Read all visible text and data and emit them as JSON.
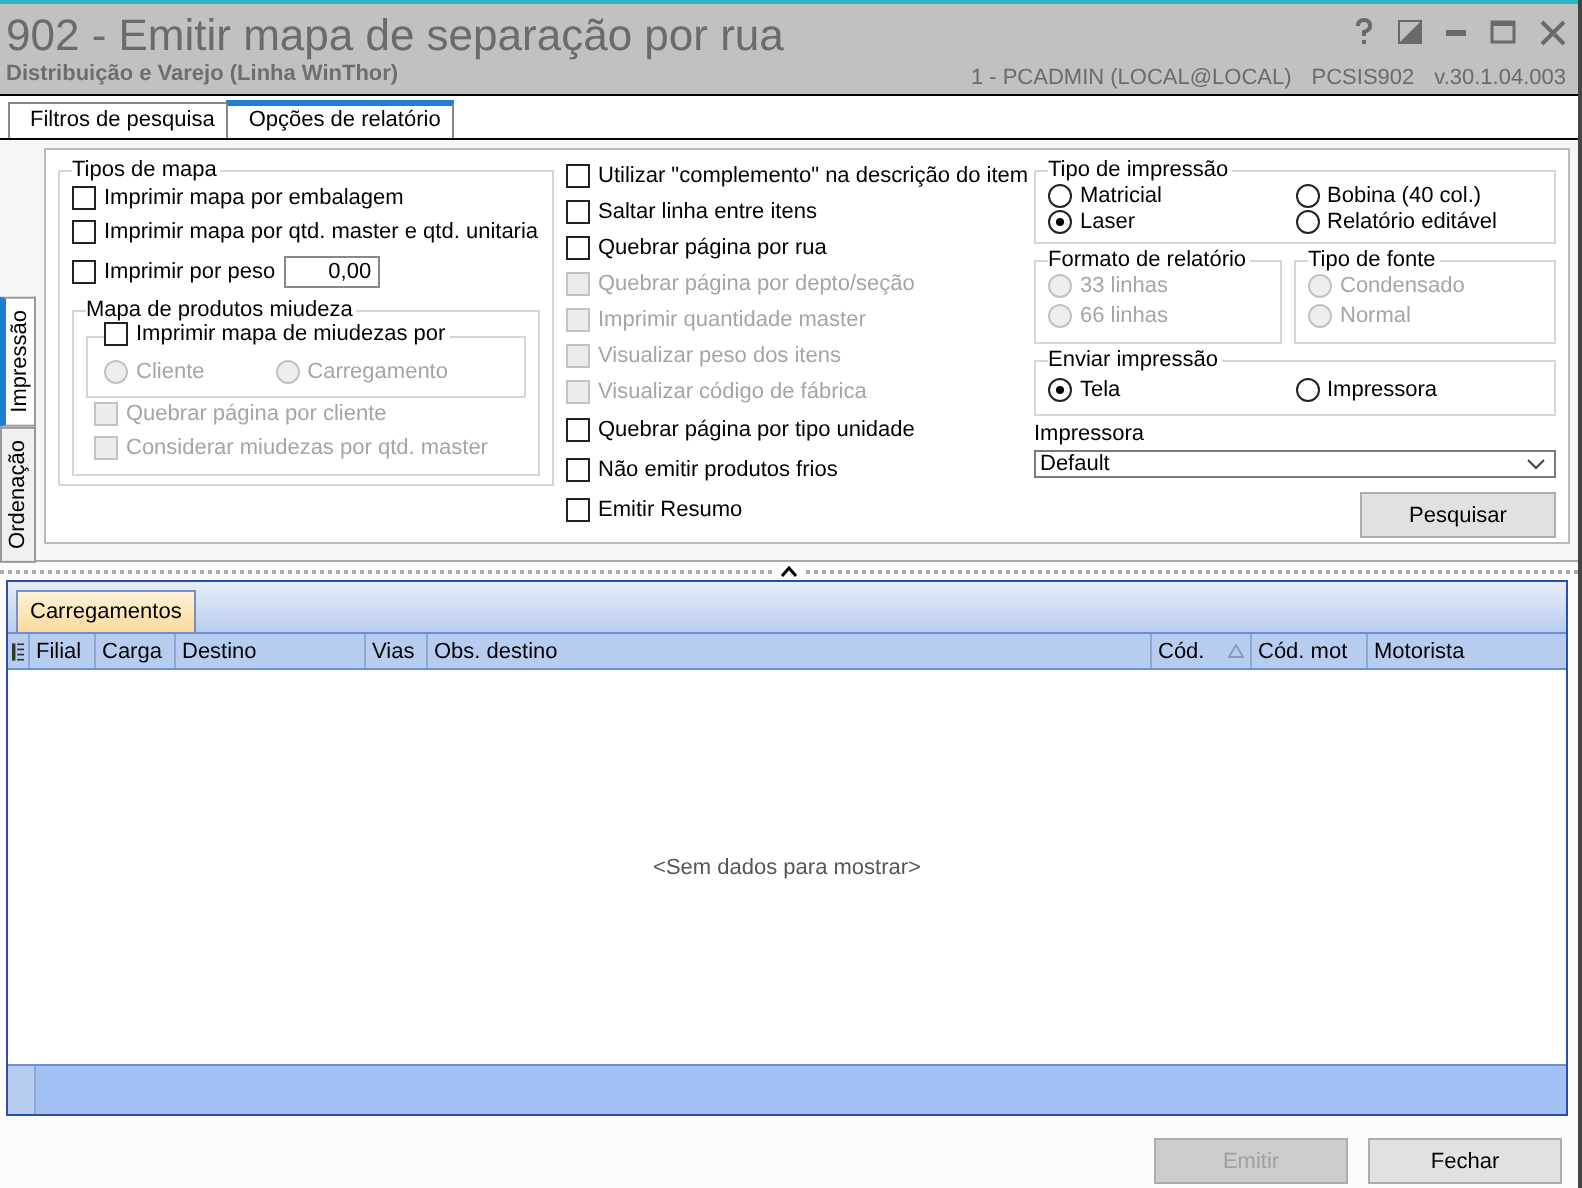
{
  "window": {
    "title": "902 - Emitir mapa de separação por rua",
    "subtitle": "Distribuição e Varejo (Linha WinThor)",
    "user": "1 - PCADMIN (LOCAL@LOCAL)",
    "program": "PCSIS902",
    "version": "v.30.1.04.003"
  },
  "tabs": [
    {
      "label": "Filtros de pesquisa",
      "selected": false
    },
    {
      "label": "Opções de relatório",
      "selected": true
    }
  ],
  "side_tabs": [
    {
      "label": "Impressão",
      "selected": true
    },
    {
      "label": "Ordenação",
      "selected": false
    }
  ],
  "tipos_de_mapa": {
    "legend": "Tipos de mapa",
    "options": [
      {
        "label": "Imprimir mapa por embalagem",
        "checked": false,
        "disabled": false
      },
      {
        "label": "Imprimir mapa por qtd. master e qtd. unitaria",
        "checked": false,
        "disabled": false
      },
      {
        "label": "Imprimir por peso",
        "checked": false,
        "disabled": false,
        "field_value": "0,00"
      }
    ],
    "miudeza": {
      "legend": "Mapa de produtos miudeza",
      "toggle": {
        "label": "Imprimir mapa de miudezas por",
        "checked": false,
        "disabled": false
      },
      "radios": [
        {
          "label": "Cliente",
          "selected": false,
          "disabled": true
        },
        {
          "label": "Carregamento",
          "selected": false,
          "disabled": true
        }
      ],
      "options": [
        {
          "label": "Quebrar página por cliente",
          "checked": false,
          "disabled": true
        },
        {
          "label": "Considerar miudezas por qtd. master",
          "checked": false,
          "disabled": true
        }
      ]
    }
  },
  "options": [
    {
      "label": "Utilizar \"complemento\" na descrição do item",
      "checked": false,
      "disabled": false
    },
    {
      "label": "Saltar linha entre itens",
      "checked": false,
      "disabled": false
    },
    {
      "label": "Quebrar página por rua",
      "checked": false,
      "disabled": false
    },
    {
      "label": "Quebrar página por depto/seção",
      "checked": false,
      "disabled": true
    },
    {
      "label": "Imprimir quantidade master",
      "checked": false,
      "disabled": true
    },
    {
      "label": "Visualizar peso dos itens",
      "checked": false,
      "disabled": true
    },
    {
      "label": "Visualizar código de fábrica",
      "checked": false,
      "disabled": true
    },
    {
      "label": "Quebrar página por tipo unidade",
      "checked": false,
      "disabled": false
    },
    {
      "label": "Não emitir produtos frios",
      "checked": false,
      "disabled": false
    },
    {
      "label": "Emitir Resumo",
      "checked": false,
      "disabled": false
    }
  ],
  "tipo_impressao": {
    "legend": "Tipo de impressão",
    "radios": [
      {
        "label": "Matricial",
        "selected": false,
        "disabled": false
      },
      {
        "label": "Bobina (40 col.)",
        "selected": false,
        "disabled": false
      },
      {
        "label": "Laser",
        "selected": true,
        "disabled": false
      },
      {
        "label": "Relatório editável",
        "selected": false,
        "disabled": false
      }
    ]
  },
  "formato_relatorio": {
    "legend": "Formato de relatório",
    "radios": [
      {
        "label": "33 linhas",
        "selected": false,
        "disabled": true
      },
      {
        "label": "66 linhas",
        "selected": false,
        "disabled": true
      }
    ]
  },
  "tipo_fonte": {
    "legend": "Tipo de fonte",
    "radios": [
      {
        "label": "Condensado",
        "selected": false,
        "disabled": true
      },
      {
        "label": "Normal",
        "selected": false,
        "disabled": true
      }
    ]
  },
  "enviar_impressao": {
    "legend": "Enviar impressão",
    "radios": [
      {
        "label": "Tela",
        "selected": true,
        "disabled": false
      },
      {
        "label": "Impressora",
        "selected": false,
        "disabled": false
      }
    ]
  },
  "impressora": {
    "label": "Impressora",
    "value": "Default"
  },
  "search_button": {
    "label": "Pesquisar",
    "disabled": false
  },
  "grid": {
    "tab": "Carregamentos",
    "columns": [
      {
        "label": "Filial",
        "sorted": false
      },
      {
        "label": "Carga",
        "sorted": false
      },
      {
        "label": "Destino",
        "sorted": false
      },
      {
        "label": "Vias",
        "sorted": false
      },
      {
        "label": "Obs. destino",
        "sorted": false
      },
      {
        "label": "Cód.",
        "sorted": true
      },
      {
        "label": "Cód. mot",
        "sorted": false
      },
      {
        "label": "Motorista",
        "sorted": false
      }
    ],
    "empty_message": "<Sem dados para mostrar>"
  },
  "buttons": [
    {
      "label": "Emitir",
      "disabled": true
    },
    {
      "label": "Fechar",
      "disabled": false
    }
  ]
}
